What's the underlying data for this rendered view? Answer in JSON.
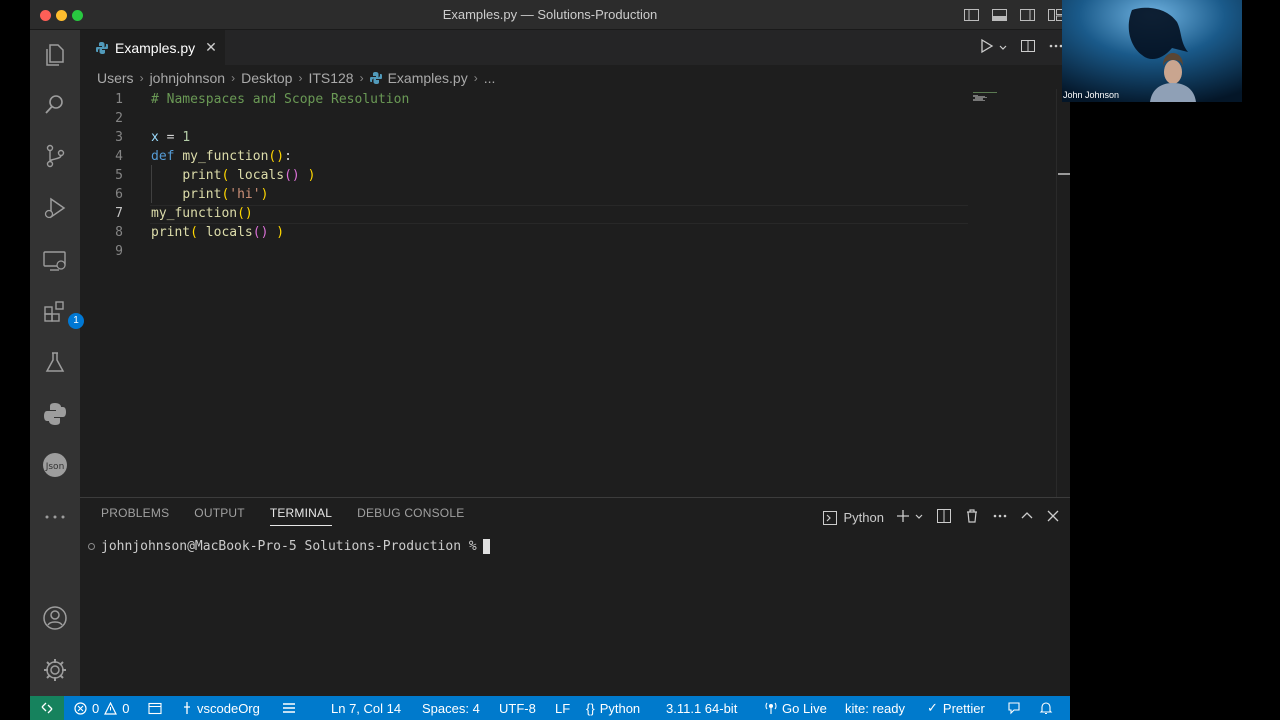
{
  "window": {
    "title": "Examples.py — Solutions-Production"
  },
  "activity_bar": {
    "extensions_badge": "1"
  },
  "tabs": [
    {
      "label": "Examples.py"
    }
  ],
  "breadcrumb": [
    "Users",
    "johnjohnson",
    "Desktop",
    "ITS128",
    "Examples.py",
    "..."
  ],
  "editor": {
    "line_numbers": [
      "1",
      "2",
      "3",
      "4",
      "5",
      "6",
      "7",
      "8",
      "9"
    ],
    "active_line": "7",
    "lines": [
      {
        "tokens": [
          {
            "t": "# Namespaces and Scope Resolution",
            "c": "c-com"
          }
        ]
      },
      {
        "tokens": []
      },
      {
        "tokens": [
          {
            "t": "x",
            "c": "c-var"
          },
          {
            "t": " = ",
            "c": ""
          },
          {
            "t": "1",
            "c": "c-num"
          }
        ]
      },
      {
        "tokens": [
          {
            "t": "def",
            "c": "c-kw"
          },
          {
            "t": " ",
            "c": ""
          },
          {
            "t": "my_function",
            "c": "c-fn"
          },
          {
            "t": "()",
            "c": "c-p1"
          },
          {
            "t": ":",
            "c": ""
          }
        ]
      },
      {
        "tokens": [
          {
            "t": "    ",
            "c": ""
          },
          {
            "t": "print",
            "c": "c-fn"
          },
          {
            "t": "(",
            "c": "c-p1"
          },
          {
            "t": " ",
            "c": ""
          },
          {
            "t": "locals",
            "c": "c-fn"
          },
          {
            "t": "()",
            "c": "c-p2"
          },
          {
            "t": " ",
            "c": ""
          },
          {
            "t": ")",
            "c": "c-p1"
          }
        ]
      },
      {
        "tokens": [
          {
            "t": "    ",
            "c": ""
          },
          {
            "t": "print",
            "c": "c-fn"
          },
          {
            "t": "(",
            "c": "c-p1"
          },
          {
            "t": "'hi'",
            "c": "c-str"
          },
          {
            "t": ")",
            "c": "c-p1"
          }
        ]
      },
      {
        "tokens": [
          {
            "t": "my_function",
            "c": "c-fn"
          },
          {
            "t": "()",
            "c": "c-p1"
          }
        ]
      },
      {
        "tokens": [
          {
            "t": "print",
            "c": "c-fn"
          },
          {
            "t": "(",
            "c": "c-p1"
          },
          {
            "t": " ",
            "c": ""
          },
          {
            "t": "locals",
            "c": "c-fn"
          },
          {
            "t": "()",
            "c": "c-p2"
          },
          {
            "t": " ",
            "c": ""
          },
          {
            "t": ")",
            "c": "c-p1"
          }
        ]
      },
      {
        "tokens": []
      }
    ]
  },
  "panel": {
    "tabs": [
      "PROBLEMS",
      "OUTPUT",
      "TERMINAL",
      "DEBUG CONSOLE"
    ],
    "active_tab": "TERMINAL",
    "terminal_name": "Python",
    "prompt": "johnjohnson@MacBook-Pro-5 Solutions-Production %"
  },
  "statusbar": {
    "errors": "0",
    "warnings": "0",
    "org": "vscodeOrg",
    "position": "Ln 7, Col 14",
    "spaces": "Spaces: 4",
    "encoding": "UTF-8",
    "eol": "LF",
    "language": "Python",
    "interpreter": "3.11.1 64-bit",
    "golive": "Go Live",
    "kite": "kite: ready",
    "prettier": "Prettier"
  },
  "video": {
    "name": "John Johnson"
  },
  "colors": {
    "accent": "#007acc",
    "remote": "#16825d",
    "badge": "#0078d4"
  }
}
